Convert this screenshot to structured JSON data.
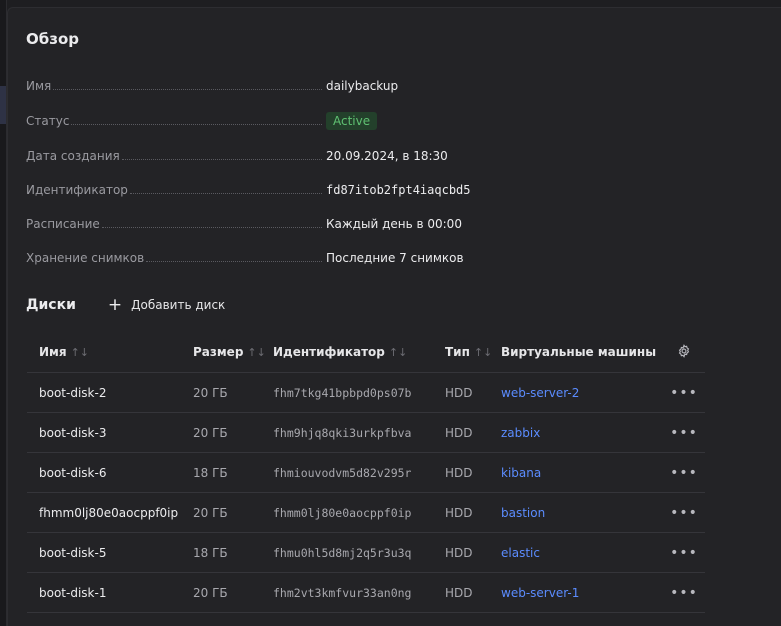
{
  "overview": {
    "title": "Обзор",
    "fields": [
      {
        "label": "Имя",
        "value": "dailybackup"
      },
      {
        "label": "Статус",
        "value": "Active"
      },
      {
        "label": "Дата создания",
        "value": "20.09.2024, в 18:30"
      },
      {
        "label": "Идентификатор",
        "value": "fd87itob2fpt4iaqcbd5"
      },
      {
        "label": "Расписание",
        "value": "Каждый день в 00:00"
      },
      {
        "label": "Хранение снимков",
        "value": "Последние 7 снимков"
      }
    ],
    "status_color": "#5fc072"
  },
  "disks": {
    "title": "Диски",
    "add_label": "Добавить диск",
    "columns": {
      "name": "Имя",
      "size": "Размер",
      "id": "Идентификатор",
      "type": "Тип",
      "vms": "Виртуальные машины"
    },
    "sort_icon": "↑↓",
    "rows": [
      {
        "name": "boot-disk-2",
        "size": "20 ГБ",
        "id": "fhm7tkg41bpbpd0ps07b",
        "type": "HDD",
        "vm": "web-server-2"
      },
      {
        "name": "boot-disk-3",
        "size": "20 ГБ",
        "id": "fhm9hjq8qki3urkpfbva",
        "type": "HDD",
        "vm": "zabbix"
      },
      {
        "name": "boot-disk-6",
        "size": "18 ГБ",
        "id": "fhmiouvodvm5d82v295r",
        "type": "HDD",
        "vm": "kibana"
      },
      {
        "name": "fhmm0lj80e0aocppf0ip",
        "size": "20 ГБ",
        "id": "fhmm0lj80e0aocppf0ip",
        "type": "HDD",
        "vm": "bastion"
      },
      {
        "name": "boot-disk-5",
        "size": "18 ГБ",
        "id": "fhmu0hl5d8mj2q5r3u3q",
        "type": "HDD",
        "vm": "elastic"
      },
      {
        "name": "boot-disk-1",
        "size": "20 ГБ",
        "id": "fhm2vt3kmfvur33an0ng",
        "type": "HDD",
        "vm": "web-server-1"
      }
    ],
    "more_icon": "•••",
    "link_color": "#5b8cff"
  }
}
